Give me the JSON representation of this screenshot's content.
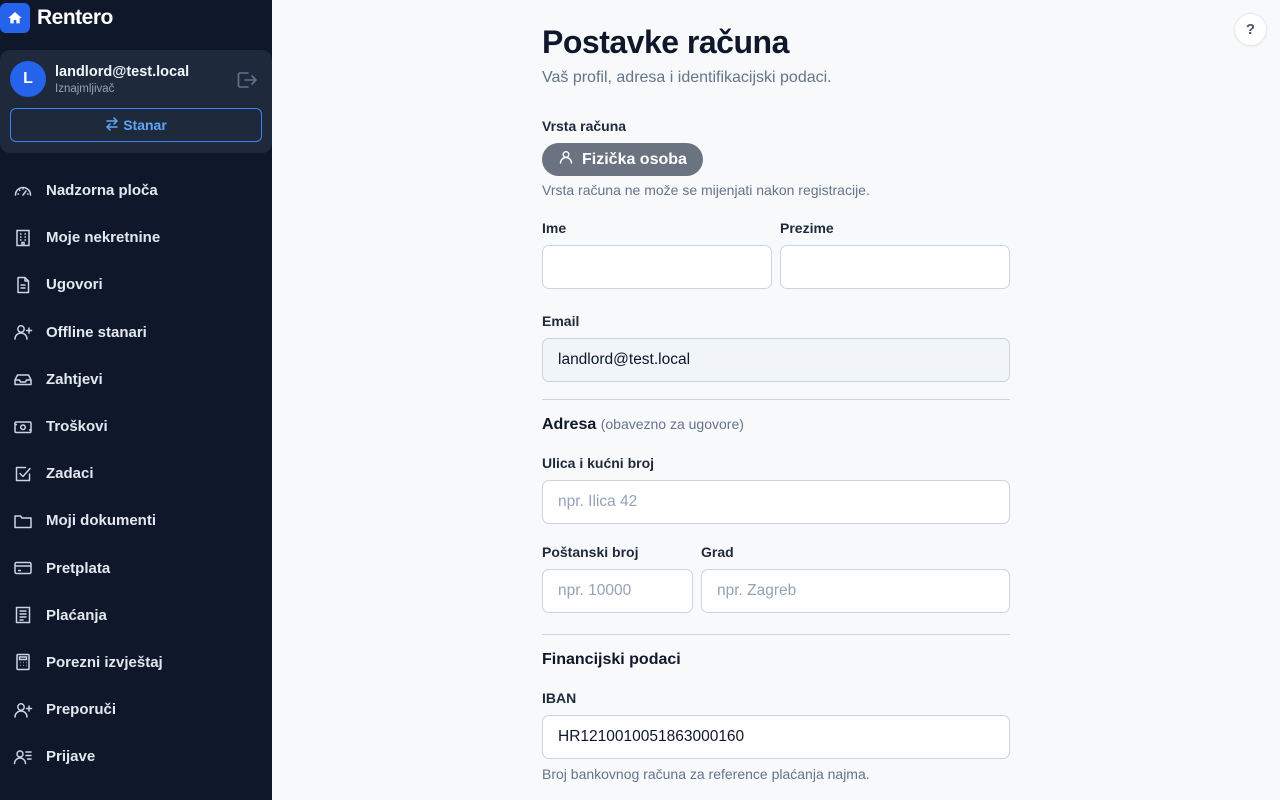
{
  "app": {
    "name": "Rentero"
  },
  "user": {
    "initial": "L",
    "email": "landlord@test.local",
    "role": "Iznajmljivač",
    "switch_label": "Stanar"
  },
  "nav": [
    {
      "label": "Nadzorna ploča",
      "icon": "dashboard-icon"
    },
    {
      "label": "Moje nekretnine",
      "icon": "building-icon"
    },
    {
      "label": "Ugovori",
      "icon": "document-icon"
    },
    {
      "label": "Offline stanari",
      "icon": "user-plus-icon"
    },
    {
      "label": "Zahtjevi",
      "icon": "inbox-icon"
    },
    {
      "label": "Troškovi",
      "icon": "cash-icon"
    },
    {
      "label": "Zadaci",
      "icon": "checkbox-icon"
    },
    {
      "label": "Moji dokumenti",
      "icon": "folder-icon"
    },
    {
      "label": "Pretplata",
      "icon": "credit-card-icon"
    },
    {
      "label": "Plaćanja",
      "icon": "receipt-icon"
    },
    {
      "label": "Porezni izvještaj",
      "icon": "calculator-icon"
    },
    {
      "label": "Preporuči",
      "icon": "user-plus-icon"
    },
    {
      "label": "Prijave",
      "icon": "user-list-icon"
    }
  ],
  "help": {
    "label": "?"
  },
  "page": {
    "title": "Postavke računa",
    "subtitle": "Vaš profil, adresa i identifikacijski podaci."
  },
  "account_type": {
    "label": "Vrsta računa",
    "value": "Fizička osoba",
    "hint": "Vrsta računa ne može se mijenjati nakon registracije."
  },
  "fields": {
    "first_name": {
      "label": "Ime",
      "value": ""
    },
    "last_name": {
      "label": "Prezime",
      "value": ""
    },
    "email": {
      "label": "Email",
      "value": "landlord@test.local"
    }
  },
  "address": {
    "title": "Adresa",
    "note": "(obavezno za ugovore)",
    "street": {
      "label": "Ulica i kućni broj",
      "placeholder": "npr. Ilica 42"
    },
    "postal": {
      "label": "Poštanski broj",
      "placeholder": "npr. 10000"
    },
    "city": {
      "label": "Grad",
      "placeholder": "npr. Zagreb"
    }
  },
  "financial": {
    "title": "Financijski podaci",
    "iban": {
      "label": "IBAN",
      "value": "HR1210010051863000160",
      "hint": "Broj bankovnog računa za reference plaćanja najma."
    }
  },
  "colors": {
    "sidebar_bg": "#0f172a",
    "accent": "#2563eb",
    "pill_bg": "#6b7280"
  }
}
